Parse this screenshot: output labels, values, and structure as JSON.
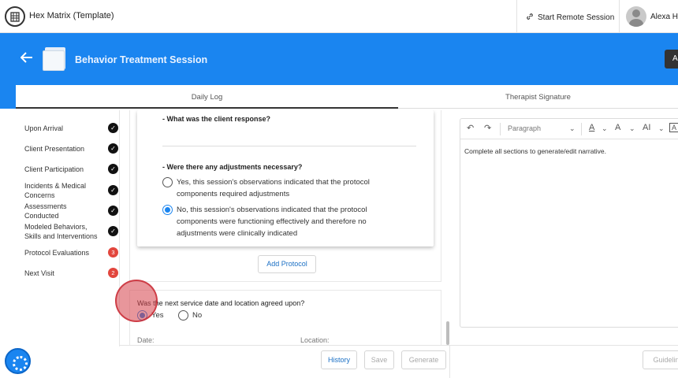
{
  "app": {
    "title": "Hex Matrix (Template)"
  },
  "topbar": {
    "remote_session": "Start Remote Session",
    "user_name": "Alexa He"
  },
  "header": {
    "title": "Behavior Treatment Session",
    "action_label": "A"
  },
  "tabs": [
    {
      "label": "Daily Log"
    },
    {
      "label": "Therapist Signature"
    }
  ],
  "sidebar": {
    "items": [
      {
        "label": "Upon Arrival",
        "status": "complete"
      },
      {
        "label": "Client Presentation",
        "status": "complete"
      },
      {
        "label": "Client Participation",
        "status": "complete"
      },
      {
        "label": "Incidents & Medical Concerns",
        "status": "complete"
      },
      {
        "label": "Assessments Conducted",
        "status": "complete"
      },
      {
        "label": "Modeled Behaviors, Skills and Interventions",
        "status": "complete"
      },
      {
        "label": "Protocol Evaluations",
        "status": "badge",
        "count": "3"
      },
      {
        "label": "Next Visit",
        "status": "badge",
        "count": "2"
      }
    ]
  },
  "protocol_card": {
    "question_response": "- What was the client response?",
    "question_adjustments": "- Were there any adjustments necessary?",
    "option_yes": "Yes, this session's observations indicated that the protocol components required adjustments",
    "option_no": "No, this session's observations indicated that the protocol components were functioning effectively and therefore no adjustments were clinically indicated",
    "selected": "no"
  },
  "add_protocol_label": "Add Protocol",
  "next_visit": {
    "question": "Was the next service date and location agreed upon?",
    "yes_label": "Yes",
    "no_label": "No",
    "selected": "yes",
    "date_label": "Date:",
    "location_label": "Location:"
  },
  "editor": {
    "block_style": "Paragraph",
    "narrative": "Complete all sections to generate/edit narrative."
  },
  "footer": {
    "history_label": "History",
    "save_label": "Save",
    "generate_label": "Generate",
    "guidelines_label": "Guidelin"
  },
  "colors": {
    "brand_blue": "#1a85f0",
    "badge_red": "#e2463d",
    "link_blue": "#1a6fc4"
  }
}
